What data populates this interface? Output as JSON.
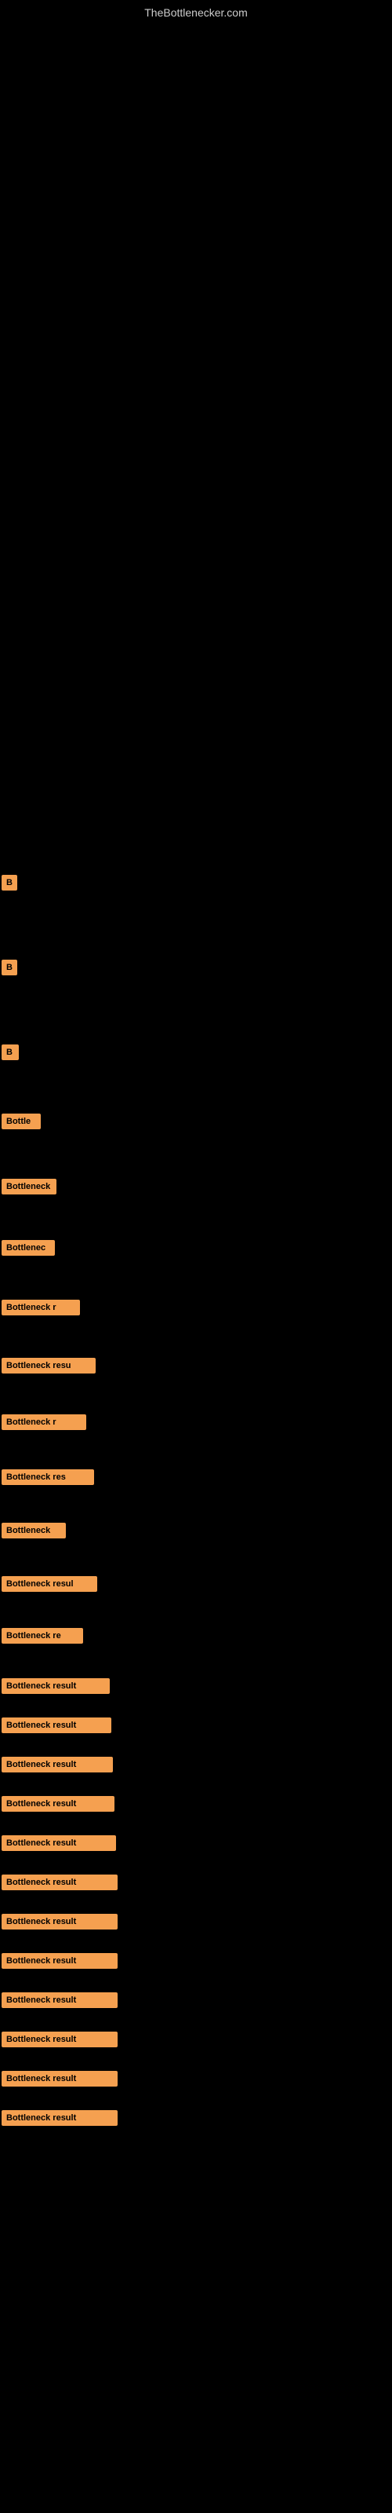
{
  "header": {
    "site_title": "TheBottlenecker.com"
  },
  "results": [
    {
      "id": 1,
      "label": "B",
      "width_class": "badge-w1"
    },
    {
      "id": 2,
      "label": "B",
      "width_class": "badge-w2"
    },
    {
      "id": 3,
      "label": "B",
      "width_class": "badge-w3"
    },
    {
      "id": 4,
      "label": "Bottle",
      "width_class": "badge-w4"
    },
    {
      "id": 5,
      "label": "Bottleneck",
      "width_class": "badge-w5"
    },
    {
      "id": 6,
      "label": "Bottlenec",
      "width_class": "badge-w6"
    },
    {
      "id": 7,
      "label": "Bottleneck r",
      "width_class": "badge-w7"
    },
    {
      "id": 8,
      "label": "Bottleneck resu",
      "width_class": "badge-w8"
    },
    {
      "id": 9,
      "label": "Bottleneck r",
      "width_class": "badge-w9"
    },
    {
      "id": 10,
      "label": "Bottleneck res",
      "width_class": "badge-w10"
    },
    {
      "id": 11,
      "label": "Bottleneck",
      "width_class": "badge-w11"
    },
    {
      "id": 12,
      "label": "Bottleneck resul",
      "width_class": "badge-w12"
    },
    {
      "id": 13,
      "label": "Bottleneck re",
      "width_class": "badge-w13"
    },
    {
      "id": 14,
      "label": "Bottleneck result",
      "width_class": "badge-w14"
    },
    {
      "id": 15,
      "label": "Bottleneck result",
      "width_class": "badge-w15"
    },
    {
      "id": 16,
      "label": "Bottleneck result",
      "width_class": "badge-w16"
    },
    {
      "id": 17,
      "label": "Bottleneck result",
      "width_class": "badge-w17"
    },
    {
      "id": 18,
      "label": "Bottleneck result",
      "width_class": "badge-w18"
    },
    {
      "id": 19,
      "label": "Bottleneck result",
      "width_class": "badge-w19"
    },
    {
      "id": 20,
      "label": "Bottleneck result",
      "width_class": "badge-w19"
    },
    {
      "id": 21,
      "label": "Bottleneck result",
      "width_class": "badge-w19"
    },
    {
      "id": 22,
      "label": "Bottleneck result",
      "width_class": "badge-w19"
    },
    {
      "id": 23,
      "label": "Bottleneck result",
      "width_class": "badge-w19"
    },
    {
      "id": 24,
      "label": "Bottleneck result",
      "width_class": "badge-w19"
    },
    {
      "id": 25,
      "label": "Bottleneck result",
      "width_class": "badge-w19"
    }
  ],
  "colors": {
    "background": "#000000",
    "badge_bg": "#f5a050",
    "text": "#000000",
    "site_title": "#cccccc"
  }
}
